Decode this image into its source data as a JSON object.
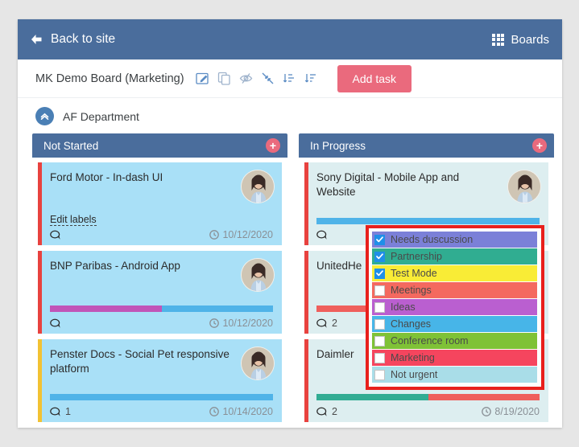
{
  "topbar": {
    "back_label": "Back to site",
    "back_icon": "arrow-left-icon",
    "boards_label": "Boards",
    "boards_icon": "grid-icon",
    "bg_color": "#4a6d9c"
  },
  "toolbar": {
    "board_title": "MK Demo Board (Marketing)",
    "icons": [
      {
        "name": "edit-board-icon"
      },
      {
        "name": "duplicate-board-icon"
      },
      {
        "name": "hide-board-icon"
      },
      {
        "name": "collapse-board-icon"
      },
      {
        "name": "sort-ascending-icon"
      },
      {
        "name": "sort-descending-icon"
      }
    ],
    "add_task_label": "Add task",
    "add_task_color": "#ea6a7d"
  },
  "department": {
    "name": "AF Department",
    "toggle_icon": "chevron-up-circle-icon"
  },
  "columns": [
    {
      "title": "Not Started",
      "add_icon": "plus-icon",
      "count": "3",
      "cards": [
        {
          "title": "Ford Motor - In-dash UI",
          "edge_color": "#e8423f",
          "tint": "tint-blue",
          "edit_labels": "Edit labels",
          "comments": "",
          "due": "10/12/2020",
          "progress": []
        },
        {
          "title": "BNP Paribas - Android App",
          "edge_color": "#e8423f",
          "tint": "tint-blue",
          "comments": "",
          "due": "10/12/2020",
          "progress": [
            {
              "color": "#c155b8",
              "pct": 50
            }
          ]
        },
        {
          "title": "Penster Docs - Social Pet responsive platform",
          "edge_color": "#f2c233",
          "tint": "tint-blue",
          "comments": "1",
          "due": "10/14/2020",
          "progress": []
        }
      ]
    },
    {
      "title": "In Progress",
      "add_icon": "plus-icon",
      "count": "3",
      "cards": [
        {
          "title": "Sony Digital - Mobile App and Website",
          "edge_color": "#e8423f",
          "tint": "tint-mint",
          "comments": "",
          "due": "",
          "progress": []
        },
        {
          "title": "UnitedHe",
          "edge_color": "#e8423f",
          "tint": "tint-mint",
          "comments": "2",
          "due": "",
          "progress": [
            {
              "color": "#ef5f5c",
              "pct": 100
            }
          ]
        },
        {
          "title": "Daimler",
          "edge_color": "#e8423f",
          "tint": "tint-mint",
          "comments": "2",
          "due": "8/19/2020",
          "progress": [
            {
              "color": "#32ac93",
              "pct": 50
            },
            {
              "color": "#ef5f5c",
              "pct": 50
            }
          ]
        }
      ]
    }
  ],
  "label_popup": {
    "border_color": "#e8201c",
    "items": [
      {
        "text": "Needs duscussion",
        "color": "#7b80d8",
        "checked": true
      },
      {
        "text": "Partnership",
        "color": "#30ad91",
        "checked": true
      },
      {
        "text": "Test Mode",
        "color": "#f9ec36",
        "checked": true
      },
      {
        "text": "Meetings",
        "color": "#f4695f",
        "checked": false
      },
      {
        "text": "Ideas",
        "color": "#ba5fd0",
        "checked": false
      },
      {
        "text": "Changes",
        "color": "#47b5e8",
        "checked": false
      },
      {
        "text": "Conference room",
        "color": "#7fc236",
        "checked": false
      },
      {
        "text": "Marketing",
        "color": "#f5455e",
        "checked": false
      },
      {
        "text": "Not urgent",
        "color": "#a9dde8",
        "checked": false
      }
    ]
  }
}
